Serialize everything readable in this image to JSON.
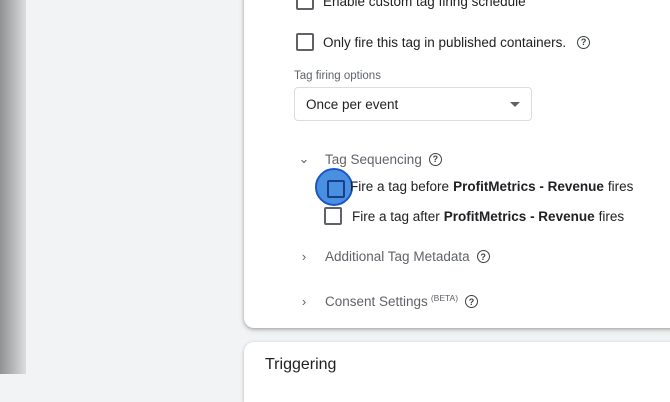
{
  "tag_settings": {
    "custom_schedule_label": "Enable custom tag firing schedule",
    "published_only_label": "Only fire this tag in published containers.",
    "help_glyph": "?",
    "firing_options_label": "Tag firing options",
    "firing_option_selected": "Once per event"
  },
  "sequencing": {
    "title": "Tag Sequencing",
    "before_prefix": "Fire a tag before",
    "before_tag": "ProfitMetrics - Revenue",
    "before_suffix": "fires",
    "after_prefix": "Fire a tag after",
    "after_tag": "ProfitMetrics - Revenue",
    "after_suffix": "fires"
  },
  "sections": {
    "metadata_title": "Additional Tag Metadata",
    "consent_title": "Consent Settings",
    "consent_badge": "(BETA)"
  },
  "triggering": {
    "title": "Triggering"
  },
  "colors": {
    "highlight": "#4a90e2",
    "text": "#202124",
    "muted": "#5f6368"
  },
  "icons": {
    "expanded": "chevron-down-icon",
    "collapsed": "chevron-right-icon",
    "help": "help-circle-icon",
    "dropdown": "caret-down-icon"
  }
}
